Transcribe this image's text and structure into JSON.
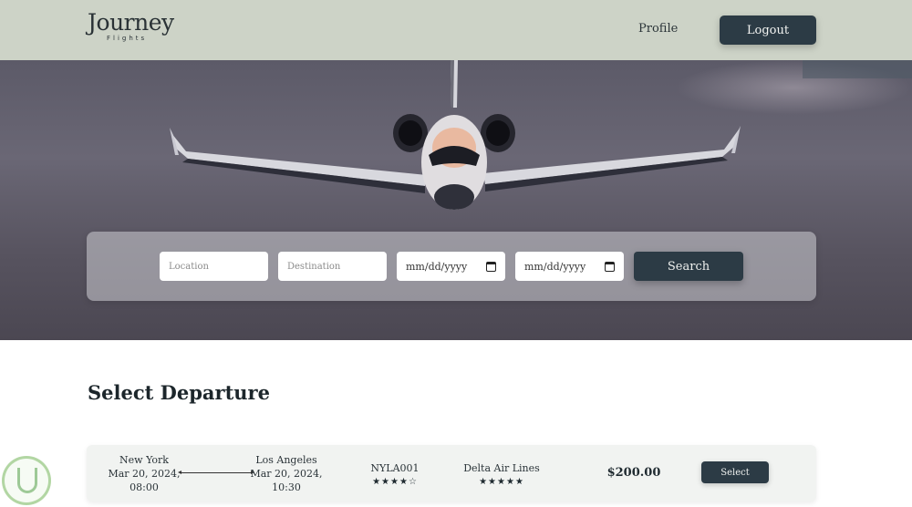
{
  "header": {
    "logo_main": "Journey",
    "logo_sub": "Flights",
    "nav_profile": "Profile",
    "logout_label": "Logout"
  },
  "search": {
    "location_placeholder": "Location",
    "destination_placeholder": "Destination",
    "date_from": "mm/dd/yyyy",
    "date_to": "mm/dd/yyyy",
    "search_label": "Search"
  },
  "results": {
    "title": "Select Departure",
    "flights": [
      {
        "origin": "New York",
        "depart_date": "Mar 20, 2024,",
        "depart_time": "08:00",
        "destination": "Los Angeles",
        "arrive_date": "Mar 20, 2024,",
        "arrive_time": "10:30",
        "flight_code": "NYLA001",
        "flight_rating": "★★★★☆",
        "airline": "Delta Air Lines",
        "airline_rating": "★★★★★",
        "price": "$200.00",
        "select_label": "Select"
      }
    ]
  },
  "colors": {
    "header_bg": "#cdd3c7",
    "accent_button": "#2c3b45",
    "card_bg": "#f1f3f1"
  }
}
